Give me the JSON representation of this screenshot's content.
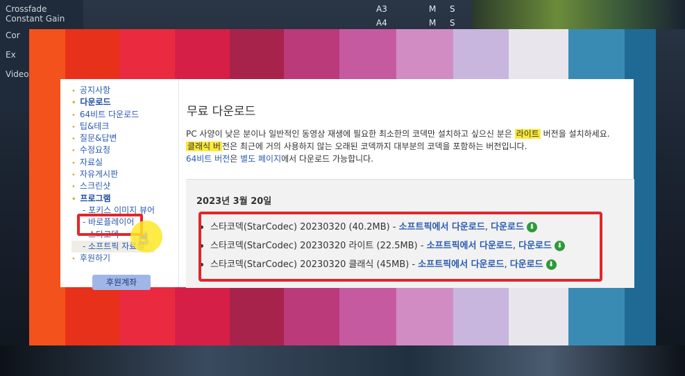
{
  "background": {
    "left_panel": [
      "Constant Gain",
      "Cor",
      "Ex",
      "Video",
      "Crossfade"
    ],
    "track_strip": [
      "A3",
      "M",
      "S",
      "A4",
      "M",
      "S"
    ]
  },
  "board_colors": [
    "#f4521c",
    "#e8311a",
    "#ea2a3e",
    "#d51f46",
    "#a8234c",
    "#bb3a7a",
    "#c65aa0",
    "#d28cc4",
    "#c8b6de",
    "#e8e6ec",
    "#3a8bb3",
    "#1f6a95"
  ],
  "sidebar": {
    "items": [
      {
        "label": "공지사항",
        "bold": false
      },
      {
        "label": "다운로드",
        "bold": true
      },
      {
        "label": "64비트 다운로드",
        "bold": false
      },
      {
        "label": "팁&테크",
        "bold": false
      },
      {
        "label": "질문&답변",
        "bold": false
      },
      {
        "label": "수정요청",
        "bold": false
      },
      {
        "label": "자료실",
        "bold": false
      },
      {
        "label": "자유게시판",
        "bold": false
      },
      {
        "label": "스크린샷",
        "bold": false
      },
      {
        "label": "프로그램",
        "bold": true
      }
    ],
    "subitems": [
      "- 포키스 이미지 뷰어",
      "- 바로플레이어",
      "- 스타코덱",
      "- 소프트픽 자료실"
    ],
    "last_item": "후원하기",
    "donate_button": "후원계좌"
  },
  "content": {
    "title": "무료 다운로드",
    "line1_pre": "PC 사양이 낮은 분이나 일반적인 동영상 재생에 필요한 최소한의 코덱만 설치하고 싶으신 분은 ",
    "line1_mark": "라이트",
    "line1_post": " 버전을 설치하세요.",
    "line2_mark": "클래식 버",
    "line2_post": "전은 최근에 거의 사용하지 않는 오래된 코덱까지 대부분의 코덱을 포함하는 버전입니다.",
    "line3_link": "64비트 버전",
    "line3_mid": "은 ",
    "line3_link2": "별도 페이지",
    "line3_post": "에서 다운로드 가능합니다.",
    "date": "2023년 3월 20일",
    "downloads": [
      {
        "name": "스타코덱(StarCodec) 20230320 (40.2MB) - ",
        "link1": "소프트픽에서 다운로드",
        "sep": ", ",
        "link2": "다운로드"
      },
      {
        "name": "스타코덱(StarCodec) 20230320 라이트 (22.5MB) - ",
        "link1": "소프트픽에서 다운로드",
        "sep": ", ",
        "link2": "다운로드"
      },
      {
        "name": "스타코덱(StarCodec) 20230320 클래식 (45MB) - ",
        "link1": "소프트픽에서 다운로드",
        "sep": ", ",
        "link2": "다운로드"
      }
    ]
  },
  "colors": {
    "annotation_red": "#e2262a",
    "link_blue": "#2a5bb0",
    "download_green": "#2e9a3a",
    "highlight_yellow": "#ffe93a"
  }
}
